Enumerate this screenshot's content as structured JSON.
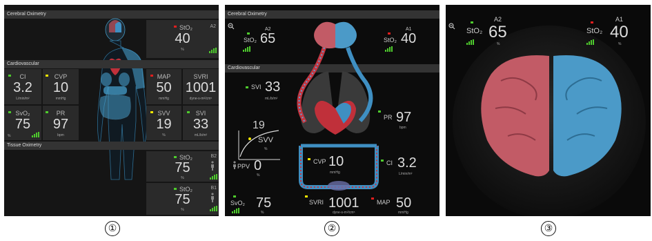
{
  "panel1": {
    "cerebral_section": "Cerebral Oximetry",
    "cerebral_tile": {
      "label": "StO₂",
      "value": "40",
      "unit": "%",
      "channel": "A2"
    },
    "cardio_section": "Cardiovascular",
    "ci": {
      "label": "CI",
      "value": "3.2",
      "unit": "L/min/m²"
    },
    "cvp": {
      "label": "CVP",
      "value": "10",
      "unit": "mmHg"
    },
    "svo2": {
      "label": "SvO₂",
      "value": "75",
      "unit": "%"
    },
    "pr": {
      "label": "PR",
      "value": "97",
      "unit": "bpm"
    },
    "map": {
      "label": "MAP",
      "value": "50",
      "unit": "mmHg"
    },
    "svri": {
      "label": "SVRI",
      "value": "1001",
      "unit": "dyne-s-m²/cm⁵"
    },
    "svv": {
      "label": "SVV",
      "value": "19",
      "unit": "%"
    },
    "svi": {
      "label": "SVI",
      "value": "33",
      "unit": "mL/b/m²"
    },
    "tissue_section": "Tissue Oximetry",
    "tissue_b2": {
      "label": "StO₂",
      "value": "75",
      "unit": "%",
      "channel": "B2"
    },
    "tissue_b1": {
      "label": "StO₂",
      "value": "75",
      "unit": "%",
      "channel": "B1"
    }
  },
  "panel2": {
    "cerebral_section": "Cerebral Oximetry",
    "cardio_section": "Cardiovascular",
    "a2": {
      "channel": "A2",
      "label": "StO₂",
      "value": "65"
    },
    "a1": {
      "channel": "A1",
      "label": "StO₂",
      "value": "40"
    },
    "svi": {
      "label": "SVI",
      "value": "33",
      "unit": "mL/b/m²"
    },
    "pr": {
      "label": "PR",
      "value": "97",
      "unit": "bpm"
    },
    "svv": {
      "label": "SVV",
      "value": "19",
      "unit": "%"
    },
    "ppv": {
      "label": "PPV",
      "value": "0",
      "unit": "%"
    },
    "cvp": {
      "label": "CVP",
      "value": "10",
      "unit": "mmHg"
    },
    "ci": {
      "label": "CI",
      "value": "3.2",
      "unit": "L/min/m²"
    },
    "svo2": {
      "label": "SvO₂",
      "value": "75",
      "unit": "%"
    },
    "svri": {
      "label": "SVRI",
      "value": "1001",
      "unit": "dyne-s-m²/cm⁵"
    },
    "map": {
      "label": "MAP",
      "value": "50",
      "unit": "mmHg"
    }
  },
  "panel3": {
    "a2": {
      "channel": "A2",
      "label": "StO₂",
      "value": "65",
      "unit": "%"
    },
    "a1": {
      "channel": "A1",
      "label": "StO₂",
      "value": "40",
      "unit": "%"
    }
  },
  "callouts": [
    "①",
    "②",
    "③"
  ],
  "colors": {
    "good": "#4ecb2d",
    "warning": "#f2e600",
    "alarm": "#e01e1e",
    "body_accent": "#49a6d6",
    "left_brain": "#c25b66",
    "right_brain": "#4b9ac8"
  },
  "icons": [
    "zoom-out-icon",
    "signal-bars-icon",
    "status-dot-icon",
    "body-location-icon"
  ]
}
